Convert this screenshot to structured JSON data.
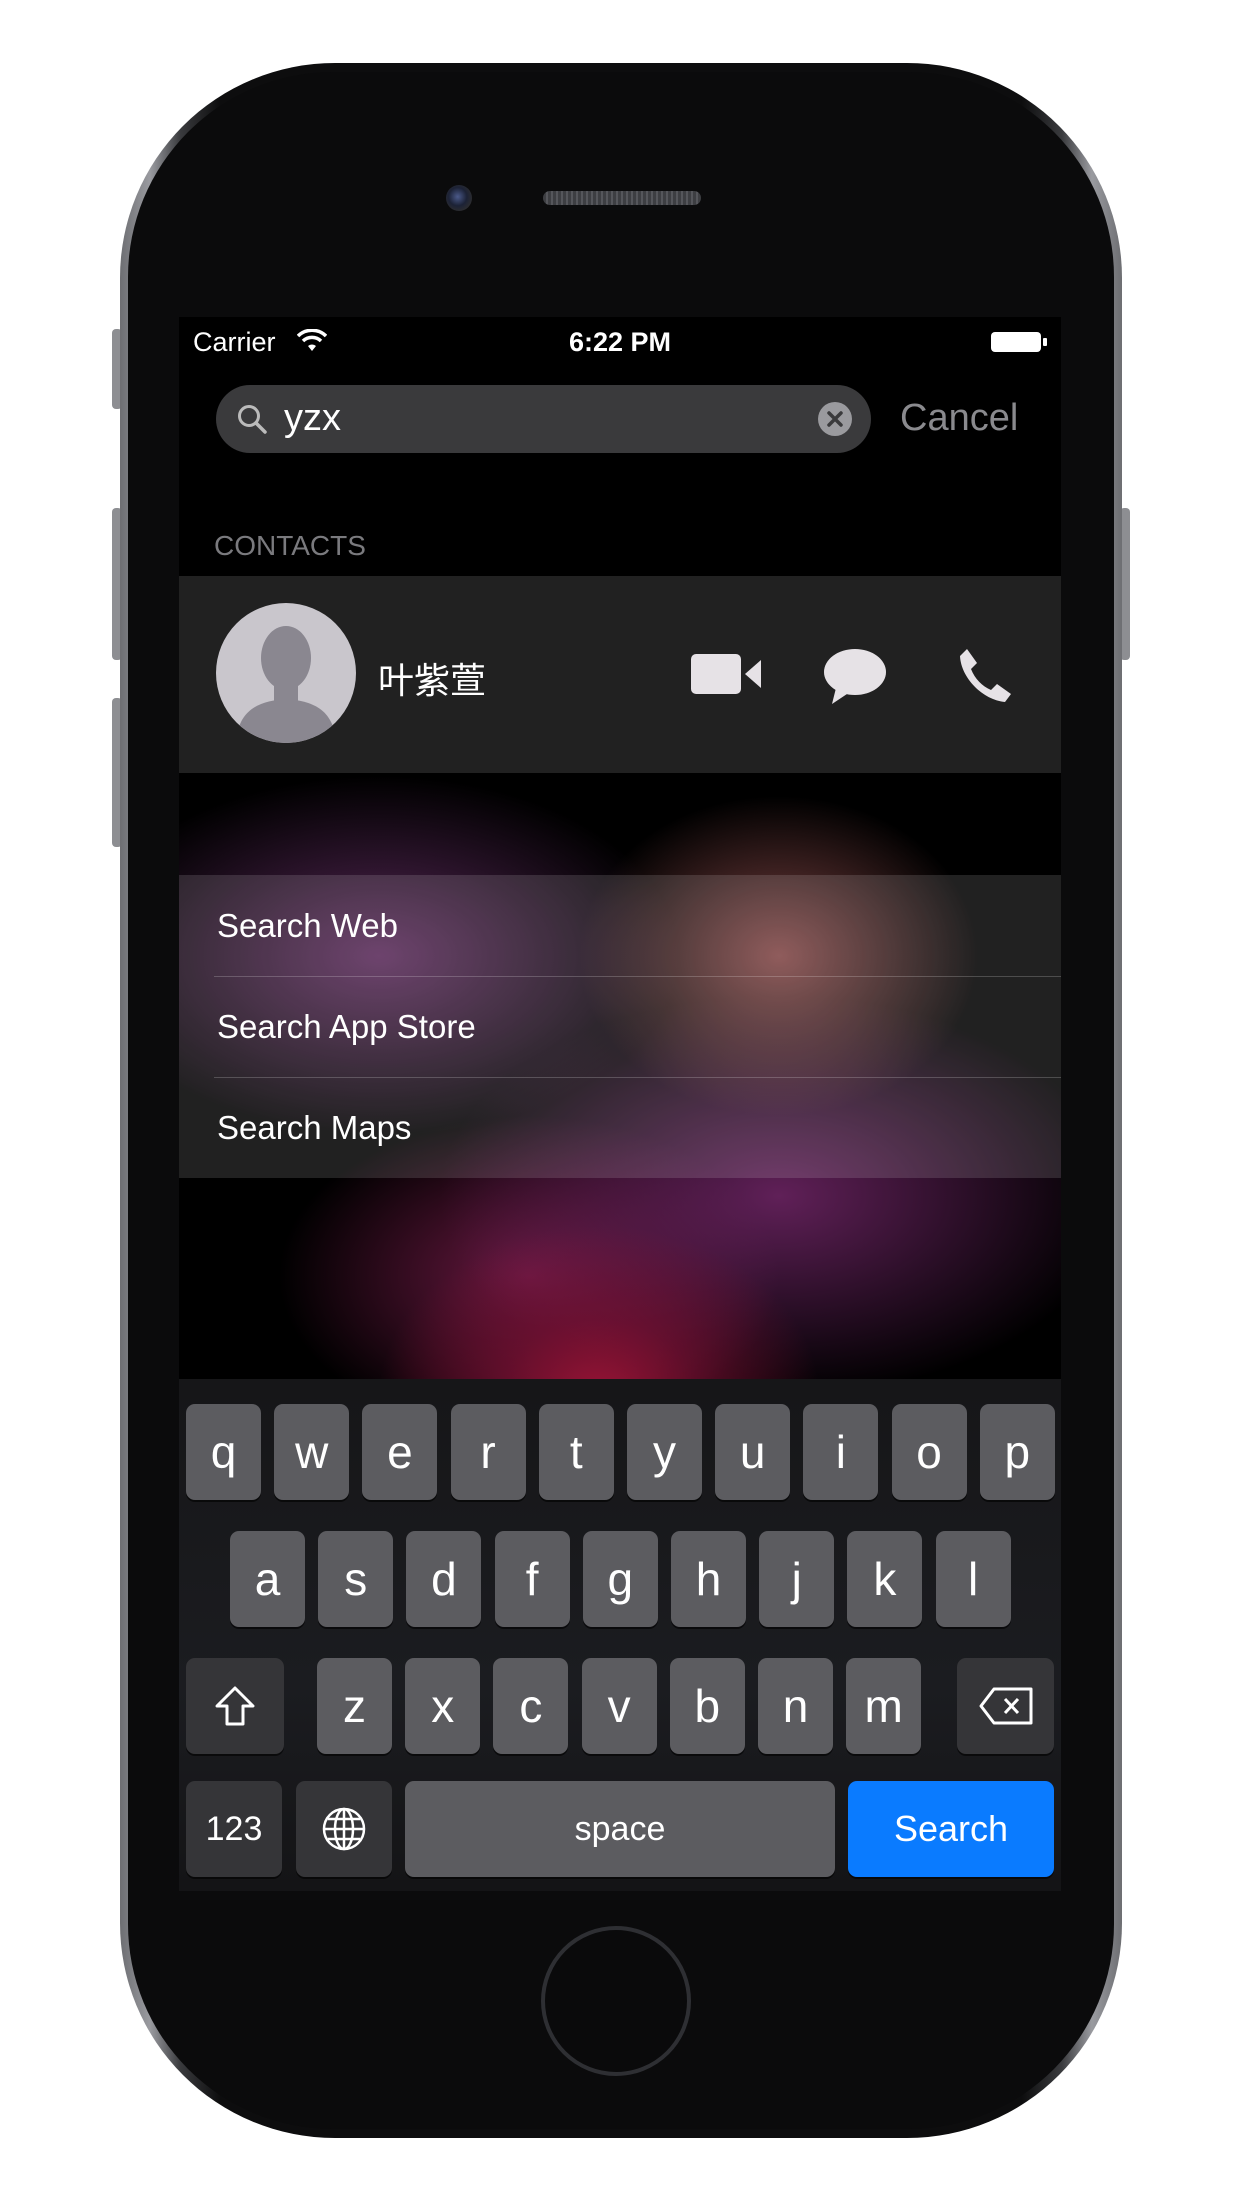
{
  "status_bar": {
    "carrier": "Carrier",
    "time": "6:22 PM"
  },
  "search": {
    "query": "yzx",
    "cancel_label": "Cancel"
  },
  "contacts": {
    "section_label": "CONTACTS",
    "items": [
      {
        "name": "叶紫萱"
      }
    ]
  },
  "suggestions": [
    {
      "label": "Search Web"
    },
    {
      "label": "Search App Store"
    },
    {
      "label": "Search Maps"
    }
  ],
  "keyboard": {
    "row1": [
      "q",
      "w",
      "e",
      "r",
      "t",
      "y",
      "u",
      "i",
      "o",
      "p"
    ],
    "row2": [
      "a",
      "s",
      "d",
      "f",
      "g",
      "h",
      "j",
      "k",
      "l"
    ],
    "row3": [
      "z",
      "x",
      "c",
      "v",
      "b",
      "n",
      "m"
    ],
    "numbers_label": "123",
    "space_label": "space",
    "return_label": "Search"
  },
  "colors": {
    "accent": "#0a7bff",
    "key": "#5c5c60",
    "key_dark": "#353538"
  }
}
